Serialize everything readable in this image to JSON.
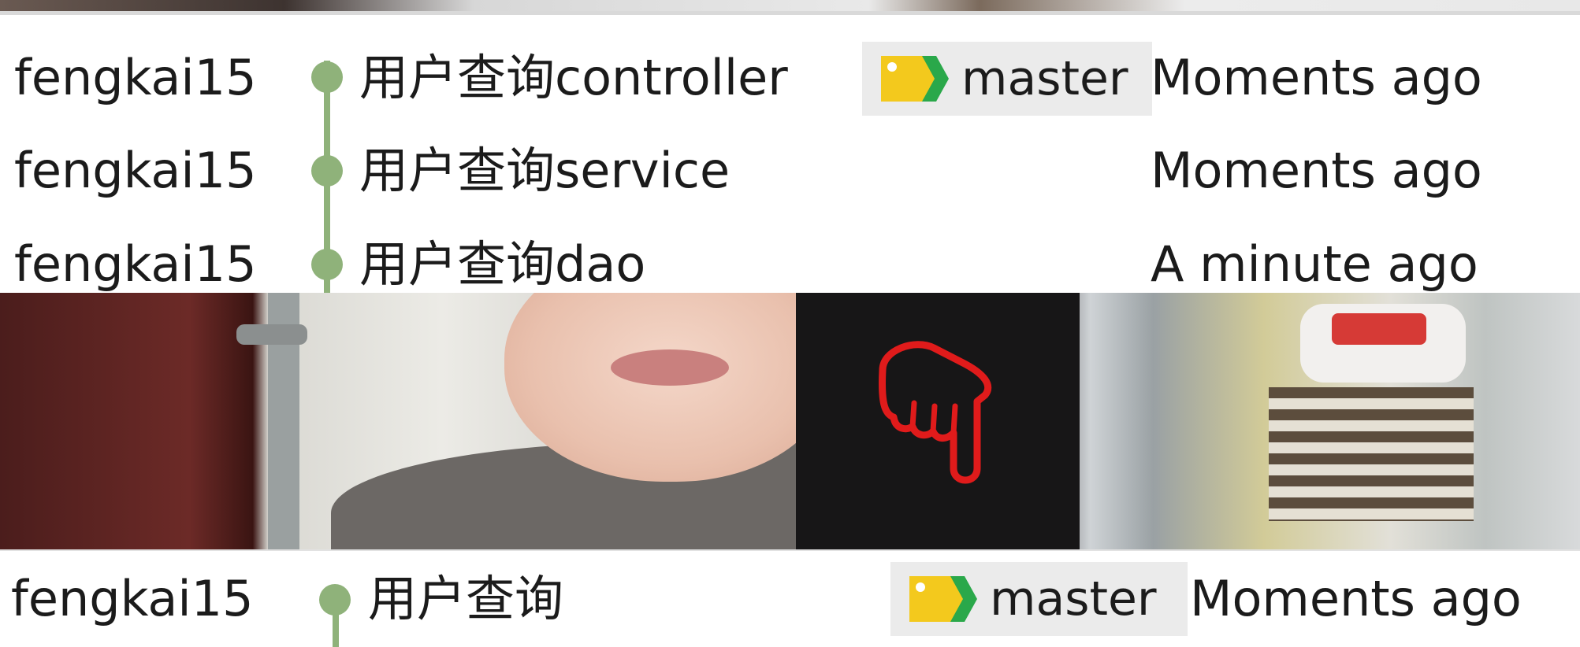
{
  "commits_top": [
    {
      "author": "fengkai15",
      "message": "用户查询controller",
      "branch": "master",
      "time": "Moments ago"
    },
    {
      "author": "fengkai15",
      "message": "用户查询service",
      "branch": "",
      "time": "Moments ago"
    },
    {
      "author": "fengkai15",
      "message": "用户查询dao",
      "branch": "",
      "time": "A minute ago"
    }
  ],
  "commits_bottom": [
    {
      "author": "fengkai15",
      "message": "用户查询",
      "branch": "master",
      "time": "Moments ago"
    }
  ],
  "icons": {
    "branch_tag": "branch-tag-icon",
    "pointer": "pointing-hand-icon"
  },
  "colors": {
    "graph": "#8fb27a",
    "tag_background": "#ebebeb",
    "tag_yellow": "#f3c91d",
    "tag_green": "#2aa84a",
    "pointer_red": "#e01b1b"
  }
}
